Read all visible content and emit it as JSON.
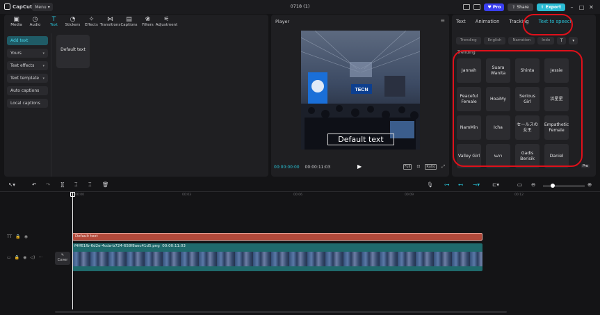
{
  "titlebar": {
    "app_name": "CapCut",
    "menu_label": "Menu",
    "project_title": "0718 (1)",
    "pro_label": "Pro",
    "share_label": "Share",
    "export_label": "Export"
  },
  "tools": [
    {
      "label": "Media",
      "icon": "media-icon"
    },
    {
      "label": "Audio",
      "icon": "audio-icon"
    },
    {
      "label": "Text",
      "icon": "text-icon"
    },
    {
      "label": "Stickers",
      "icon": "stickers-icon"
    },
    {
      "label": "Effects",
      "icon": "effects-icon"
    },
    {
      "label": "Transitions",
      "icon": "transitions-icon"
    },
    {
      "label": "Captions",
      "icon": "captions-icon"
    },
    {
      "label": "Filters",
      "icon": "filters-icon"
    },
    {
      "label": "Adjustment",
      "icon": "adjustment-icon"
    }
  ],
  "active_tool": "Text",
  "text_sidebar": {
    "add_text": "Add text",
    "yours": "Yours",
    "text_effects": "Text effects",
    "text_template": "Text template",
    "auto_captions": "Auto captions",
    "local_captions": "Local captions"
  },
  "default_text_card": "Default text",
  "player": {
    "title": "Player",
    "overlay_text": "Default text",
    "current_time": "00:00:00:00",
    "total_time": "00:00:11:03",
    "full_label": "Full",
    "ratio_label": "Ratio"
  },
  "right_tabs": [
    "Text",
    "Animation",
    "Tracking",
    "Text to speech"
  ],
  "active_right_tab": "Text to speech",
  "filter_chips": [
    "Trending",
    "English",
    "Narration",
    "Indo"
  ],
  "trending_label": "Trending",
  "voices": [
    "Jannah",
    "Suara Wanita",
    "Shinta",
    "Jessie",
    "Peaceful Female",
    "HoaiMy",
    "Serious Girl",
    "浜星星",
    "NamMin",
    "Icha",
    "セールスの女王",
    "Empathetic Female",
    "Valley Girl",
    "นภา",
    "Gadis Berisik",
    "Daniel"
  ],
  "pro_tag": "Pro",
  "ruler_labels": [
    "00:00",
    "00:03",
    "00:06",
    "00:09",
    "00:12"
  ],
  "timeline": {
    "cover_label": "Cover",
    "text_clip_label": "Default text",
    "video_clip_name": "f4ff61fb-6d2e-4cda-b724-658f8aec41d5.png",
    "video_clip_duration": "00:00:11:03"
  },
  "colors": {
    "accent": "#28c2d6",
    "text_clip": "#b2493a",
    "video_clip": "#1f6a6c",
    "highlight_circle": "#e0101a"
  }
}
